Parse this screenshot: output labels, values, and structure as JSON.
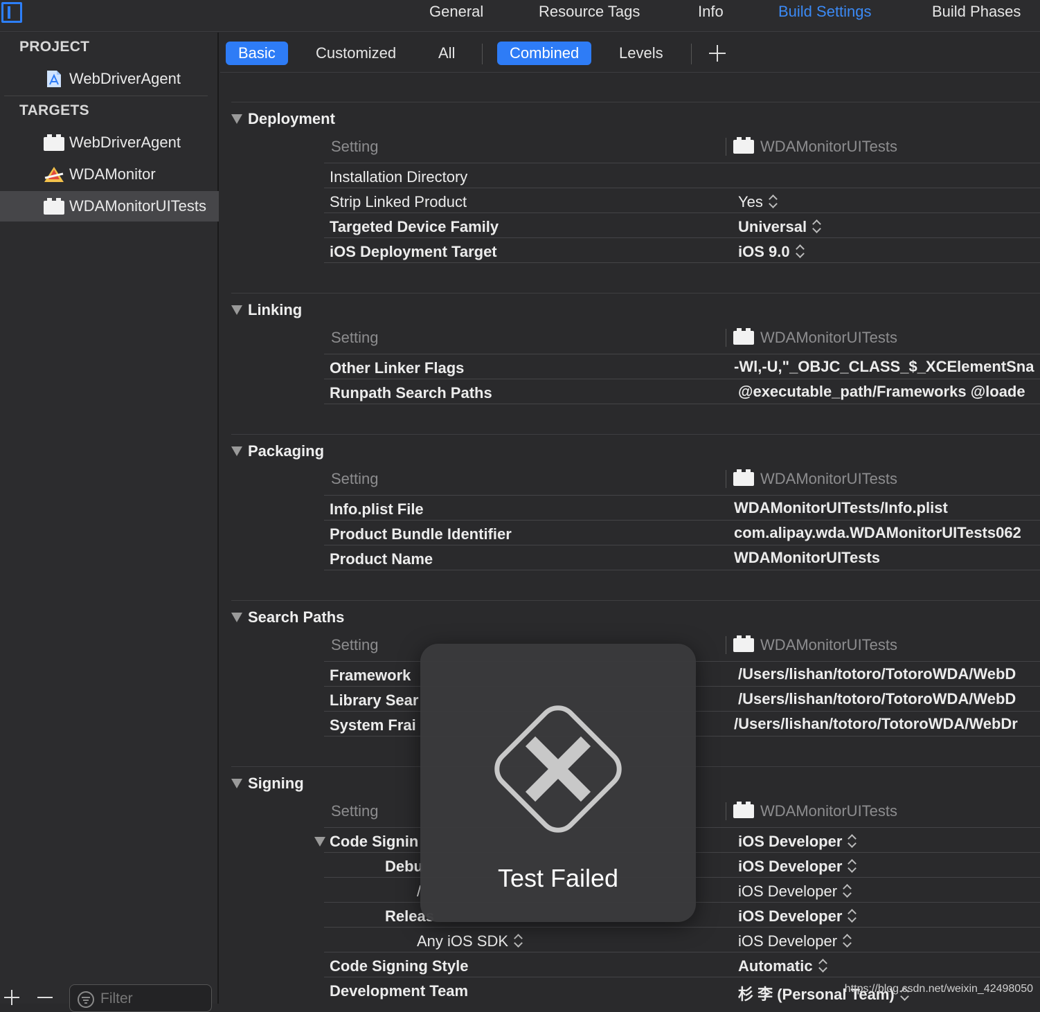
{
  "top_tabs": [
    "General",
    "Resource Tags",
    "Info",
    "Build Settings",
    "Build Phases"
  ],
  "sidebar": {
    "project_header": "PROJECT",
    "project_item": "WebDriverAgent",
    "targets_header": "TARGETS",
    "targets": [
      "WebDriverAgent",
      "WDAMonitor",
      "WDAMonitorUITests"
    ],
    "filter_placeholder": "Filter"
  },
  "scope_bar": {
    "basic": "Basic",
    "customized": "Customized",
    "all": "All",
    "combined": "Combined",
    "levels": "Levels"
  },
  "column_setting": "Setting",
  "column_target": "WDAMonitorUITests",
  "groups": {
    "deployment": {
      "title": "Deployment",
      "rows": [
        {
          "name": "Installation Directory",
          "value": ""
        },
        {
          "name": "Strip Linked Product",
          "value": "Yes"
        },
        {
          "name": "Targeted Device Family",
          "value": "Universal"
        },
        {
          "name": "iOS Deployment Target",
          "value": "iOS 9.0"
        }
      ]
    },
    "linking": {
      "title": "Linking",
      "rows": [
        {
          "name": "Other Linker Flags",
          "value": "-Wl,-U,\"_OBJC_CLASS_$_XCElementSna"
        },
        {
          "name": "Runpath Search Paths",
          "value": "@executable_path/Frameworks @loade"
        }
      ]
    },
    "packaging": {
      "title": "Packaging",
      "rows": [
        {
          "name": "Info.plist File",
          "value": "WDAMonitorUITests/Info.plist"
        },
        {
          "name": "Product Bundle Identifier",
          "value": "com.alipay.wda.WDAMonitorUITests062"
        },
        {
          "name": "Product Name",
          "value": "WDAMonitorUITests"
        }
      ]
    },
    "search_paths": {
      "title": "Search Paths",
      "rows": [
        {
          "name": "Framework",
          "value": "/Users/lishan/totoro/TotoroWDA/WebD"
        },
        {
          "name": "Library Sear",
          "value": "/Users/lishan/totoro/TotoroWDA/WebD"
        },
        {
          "name": "System Frai",
          "value": "/Users/lishan/totoro/TotoroWDA/WebDr"
        }
      ]
    },
    "signing": {
      "title": "Signing",
      "rows": [
        {
          "name": "Code Signin",
          "value": "iOS Developer"
        },
        {
          "name": "Debu",
          "value": "iOS Developer"
        },
        {
          "name": "/",
          "value": "iOS Developer"
        },
        {
          "name": "Releas",
          "value": "iOS Developer"
        },
        {
          "name": "Any iOS SDK",
          "value": "iOS Developer"
        },
        {
          "name": "Code Signing Style",
          "value": "Automatic"
        },
        {
          "name": "Development Team",
          "value": "杉 李 (Personal Team)"
        }
      ]
    }
  },
  "hud": {
    "text": "Test Failed"
  },
  "watermark": "https://blog.csdn.net/weixin_42498050",
  "colors": {
    "accent": "#2e7cf6",
    "active_tab": "#3b8af5",
    "background": "#2a2a2c"
  }
}
